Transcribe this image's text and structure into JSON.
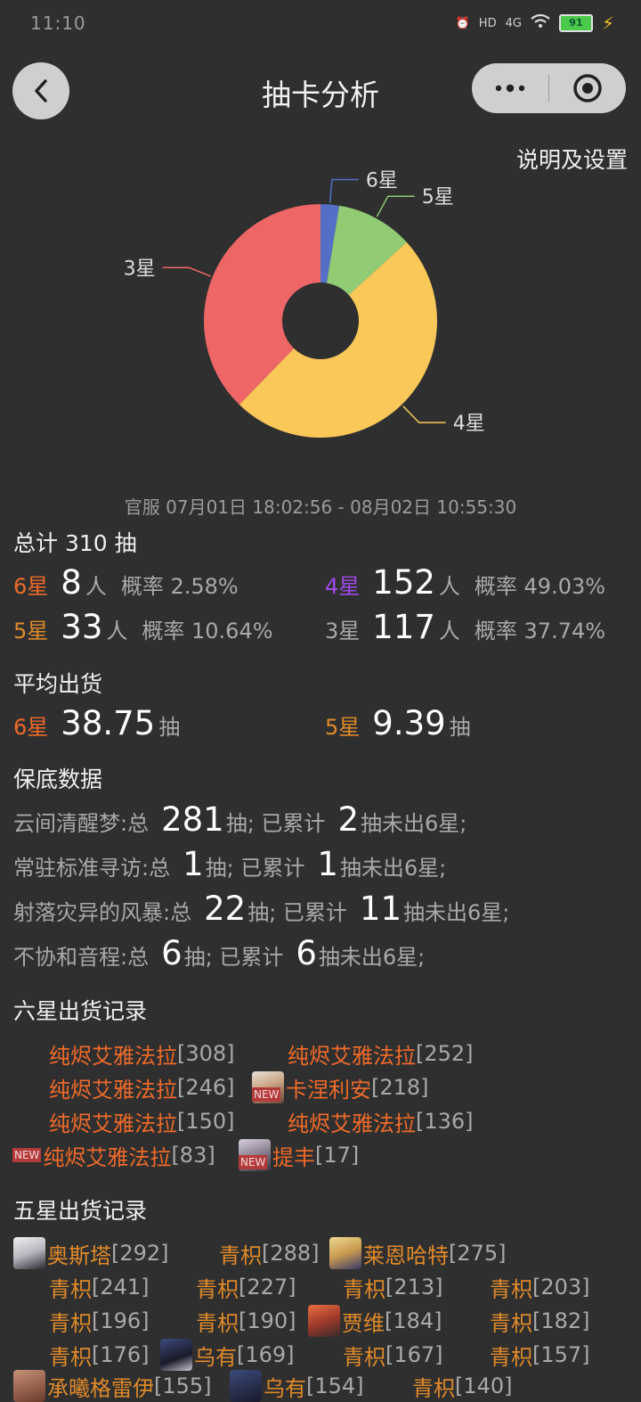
{
  "status": {
    "time": "11:10",
    "battery": "91",
    "hd": "HD",
    "network": "4G"
  },
  "nav": {
    "title": "抽卡分析",
    "settings": "说明及设置"
  },
  "chart_data": {
    "type": "pie",
    "categories": [
      "6星",
      "5星",
      "4星",
      "3星"
    ],
    "values": [
      8,
      33,
      152,
      117
    ],
    "colors": [
      "#5470c6",
      "#91cc75",
      "#fac858",
      "#ee6666"
    ],
    "donut": true
  },
  "summary": {
    "date_range": "官服  07月01日 18:02:56  -  08月02日 10:55:30",
    "total_label": "总计 310 抽",
    "stars": [
      {
        "label": "6星",
        "count": "8",
        "unit": "人",
        "rate": "概率 2.58%"
      },
      {
        "label": "4星",
        "count": "152",
        "unit": "人",
        "rate": "概率 49.03%"
      },
      {
        "label": "5星",
        "count": "33",
        "unit": "人",
        "rate": "概率 10.64%"
      },
      {
        "label": "3星",
        "count": "117",
        "unit": "人",
        "rate": "概率 37.74%"
      }
    ]
  },
  "average": {
    "title": "平均出货",
    "six": {
      "label": "6星",
      "value": "38.75",
      "unit": "抽"
    },
    "five": {
      "label": "5星",
      "value": "9.39",
      "unit": "抽"
    }
  },
  "pity": {
    "title": "保底数据",
    "rows": [
      {
        "name": "云间清醒梦:总",
        "total": "281",
        "mid": "抽;  已累计",
        "acc": "2",
        "tail": "抽未出6星;"
      },
      {
        "name": "常驻标准寻访:总",
        "total": "1",
        "mid": "抽;  已累计",
        "acc": "1",
        "tail": "抽未出6星;"
      },
      {
        "name": "射落灾异的风暴:总",
        "total": "22",
        "mid": "抽;  已累计",
        "acc": "11",
        "tail": "抽未出6星;"
      },
      {
        "name": "不协和音程:总",
        "total": "6",
        "mid": "抽;  已累计",
        "acc": "6",
        "tail": "抽未出6星;"
      }
    ]
  },
  "six_records": {
    "title": "六星出货记录",
    "new_tag": "NEW",
    "items": [
      {
        "name": "纯烬艾雅法拉",
        "num": "[308]"
      },
      {
        "name": "纯烬艾雅法拉",
        "num": "[252]"
      },
      {
        "name": "纯烬艾雅法拉",
        "num": "[246]"
      },
      {
        "name": "卡涅利安",
        "num": "[218]"
      },
      {
        "name": "纯烬艾雅法拉",
        "num": "[150]"
      },
      {
        "name": "纯烬艾雅法拉",
        "num": "[136]"
      },
      {
        "name": "纯烬艾雅法拉",
        "num": "[83]"
      },
      {
        "name": "提丰",
        "num": "[17]"
      }
    ]
  },
  "five_records": {
    "title": "五星出货记录",
    "items": [
      {
        "name": "奥斯塔",
        "num": "[292]"
      },
      {
        "name": "青枳",
        "num": "[288]"
      },
      {
        "name": "莱恩哈特",
        "num": "[275]"
      },
      {
        "name": "青枳",
        "num": "[241]"
      },
      {
        "name": "青枳",
        "num": "[227]"
      },
      {
        "name": "青枳",
        "num": "[213]"
      },
      {
        "name": "青枳",
        "num": "[203]"
      },
      {
        "name": "青枳",
        "num": "[196]"
      },
      {
        "name": "青枳",
        "num": "[190]"
      },
      {
        "name": "贾维",
        "num": "[184]"
      },
      {
        "name": "青枳",
        "num": "[182]"
      },
      {
        "name": "青枳",
        "num": "[176]"
      },
      {
        "name": "乌有",
        "num": "[169]"
      },
      {
        "name": "青枳",
        "num": "[167]"
      },
      {
        "name": "青枳",
        "num": "[157]"
      },
      {
        "name": "承曦格雷伊",
        "num": "[155]"
      },
      {
        "name": "乌有",
        "num": "[154]"
      },
      {
        "name": "青枳",
        "num": "[140]"
      }
    ]
  }
}
